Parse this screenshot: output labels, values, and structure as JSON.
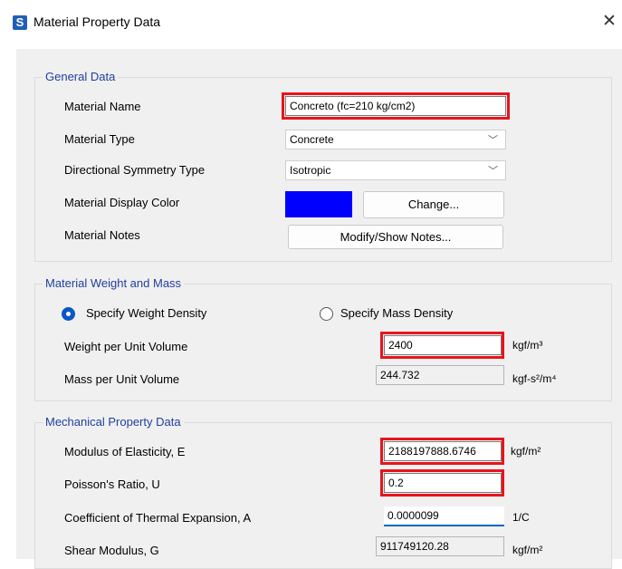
{
  "window": {
    "title": "Material Property Data",
    "app_icon_letter": "S"
  },
  "general": {
    "section_title": "General Data",
    "material_name_label": "Material Name",
    "material_name_value": "Concreto (fc=210 kg/cm2)",
    "material_type_label": "Material Type",
    "material_type_value": "Concrete",
    "symmetry_label": "Directional Symmetry Type",
    "symmetry_value": "Isotropic",
    "display_color_label": "Material Display Color",
    "display_color": "#0000ff",
    "change_button": "Change...",
    "notes_label": "Material Notes",
    "notes_button": "Modify/Show Notes..."
  },
  "weight": {
    "section_title": "Material Weight and Mass",
    "radio_weight_label": "Specify Weight Density",
    "radio_mass_label": "Specify Mass Density",
    "weight_label": "Weight per Unit Volume",
    "weight_value": "2400",
    "weight_unit": "kgf/m³",
    "mass_label": "Mass per Unit Volume",
    "mass_value": "244.732",
    "mass_unit": "kgf-s²/m⁴"
  },
  "mechanical": {
    "section_title": "Mechanical Property Data",
    "modulus_label": "Modulus of Elasticity,  E",
    "modulus_value": "2188197888.6746",
    "modulus_unit": "kgf/m²",
    "poisson_label": "Poisson's Ratio,  U",
    "poisson_value": "0.2",
    "thermal_label": "Coefficient of Thermal Expansion,  A",
    "thermal_value": "0.0000099",
    "thermal_unit": "1/C",
    "shear_label": "Shear Modulus,  G",
    "shear_value": "911749120.28",
    "shear_unit": "kgf/m²"
  },
  "colors": {
    "highlight": "#e8141c",
    "group_title": "#1f3f9f",
    "radio_selected": "#0b57c7"
  }
}
